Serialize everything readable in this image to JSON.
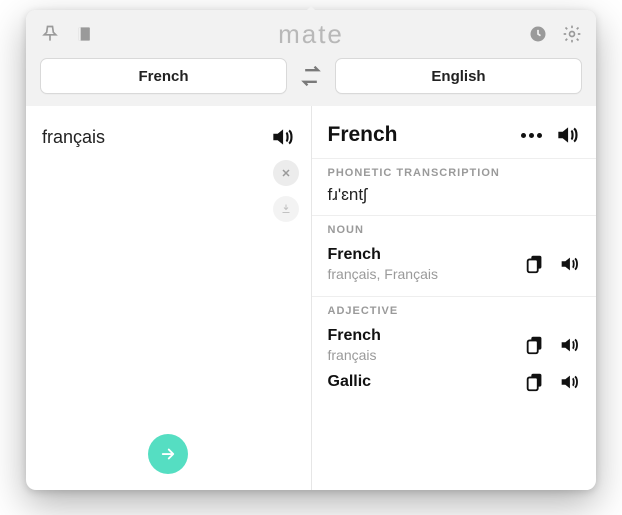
{
  "brand": "mate",
  "source_lang": "French",
  "target_lang": "English",
  "source_text": "français",
  "result_title": "French",
  "phonetic": {
    "label": "PHONETIC TRANSCRIPTION",
    "value": "fɹ'ɛntʃ"
  },
  "noun": {
    "label": "NOUN",
    "entries": [
      {
        "word": "French",
        "sub": "français, Français"
      }
    ]
  },
  "adjective": {
    "label": "ADJECTIVE",
    "entries": [
      {
        "word": "French",
        "sub": "français"
      },
      {
        "word": "Gallic",
        "sub": ""
      }
    ]
  }
}
